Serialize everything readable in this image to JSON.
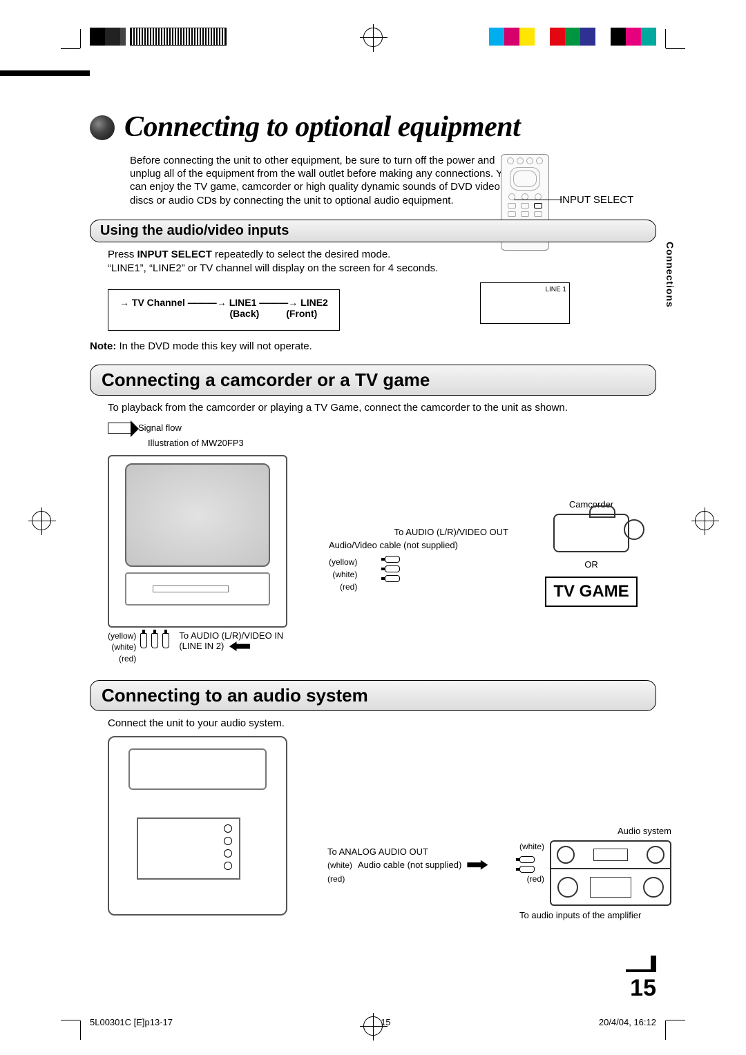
{
  "title": "Connecting to optional equipment",
  "intro": "Before connecting the unit to other equipment, be sure to turn off the power and unplug all of the equipment from the wall outlet before making any connections. You can enjoy the TV game, camcorder or high quality dynamic sounds of DVD video discs or audio CDs by connecting the unit to optional audio equipment.",
  "input_select_label": "INPUT SELECT",
  "side_tab": "Connections",
  "section1": {
    "heading": "Using the audio/video inputs",
    "line1a": "Press ",
    "input_select_bold": "INPUT SELECT",
    "line1b": " repeatedly to select the desired mode.",
    "line2": "“LINE1”, “LINE2” or TV channel will display on the screen for 4 seconds.",
    "modes": [
      "TV Channel",
      "LINE1",
      "LINE2"
    ],
    "mode_subs": [
      "(Back)",
      "(Front)"
    ],
    "osd_text": "LINE 1",
    "note_label": "Note:",
    "note_text": " In the DVD mode this key will not operate."
  },
  "section2": {
    "heading": "Connecting a camcorder or a TV game",
    "text": "To playback from the camcorder or playing a TV Game, connect the camcorder to the unit as shown.",
    "signal_flow": "Signal flow",
    "illustration_label": "Illustration of MW20FP3",
    "colors": [
      "(yellow)",
      "(white)",
      "(red)"
    ],
    "to_av_in": "To AUDIO (L/R)/VIDEO IN",
    "line_in": "(LINE IN 2)",
    "to_av_out": "To AUDIO (L/R)/VIDEO OUT",
    "cable_av": "Audio/Video cable (not supplied)",
    "camcorder_label": "Camcorder",
    "or": "OR",
    "tv_game": "TV GAME"
  },
  "section3": {
    "heading": "Connecting to an audio system",
    "text": "Connect the unit to your audio system.",
    "to_analog_out": "To ANALOG AUDIO OUT",
    "cable_audio": "Audio cable (not supplied)",
    "audio_system_label": "Audio system",
    "to_amp_inputs": "To audio inputs of the amplifier",
    "colors": [
      "(white)",
      "(red)"
    ]
  },
  "page_number": "15",
  "footer": {
    "doc_id": "5L00301C [E]p13-17",
    "page": "15",
    "date": "20/4/04, 16:12"
  }
}
